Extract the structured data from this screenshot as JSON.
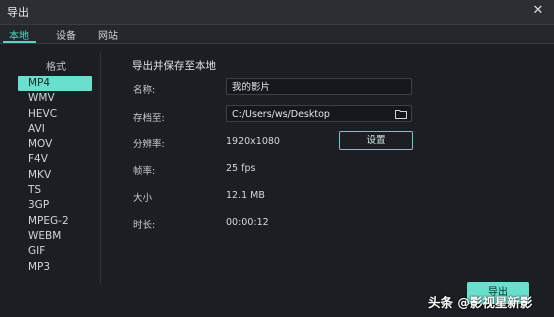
{
  "window": {
    "title": "导出",
    "close_icon": "close-icon"
  },
  "tabs": [
    {
      "label": "本地",
      "active": true
    },
    {
      "label": "设备",
      "active": false
    },
    {
      "label": "网站",
      "active": false
    }
  ],
  "formats": {
    "header": "格式",
    "items": [
      "MP4",
      "WMV",
      "HEVC",
      "AVI",
      "MOV",
      "F4V",
      "MKV",
      "TS",
      "3GP",
      "MPEG-2",
      "WEBM",
      "GIF",
      "MP3"
    ],
    "selected": "MP4"
  },
  "details": {
    "section_title": "导出并保存至本地",
    "name_label": "名称:",
    "name_value": "我的影片",
    "path_label": "存档至:",
    "path_value": "C:/Users/ws/Desktop",
    "resolution_label": "分辨率:",
    "resolution_value": "1920x1080",
    "settings_label": "设置",
    "framerate_label": "帧率:",
    "framerate_value": "25 fps",
    "size_label": "大小",
    "size_value": "12.1 MB",
    "duration_label": "时长:",
    "duration_value": "00:00:12"
  },
  "actions": {
    "export_label": "导出"
  },
  "watermark": {
    "text": "头条 @影视星新影"
  },
  "colors": {
    "accent": "#68e0cd",
    "background": "#1b1e22"
  }
}
